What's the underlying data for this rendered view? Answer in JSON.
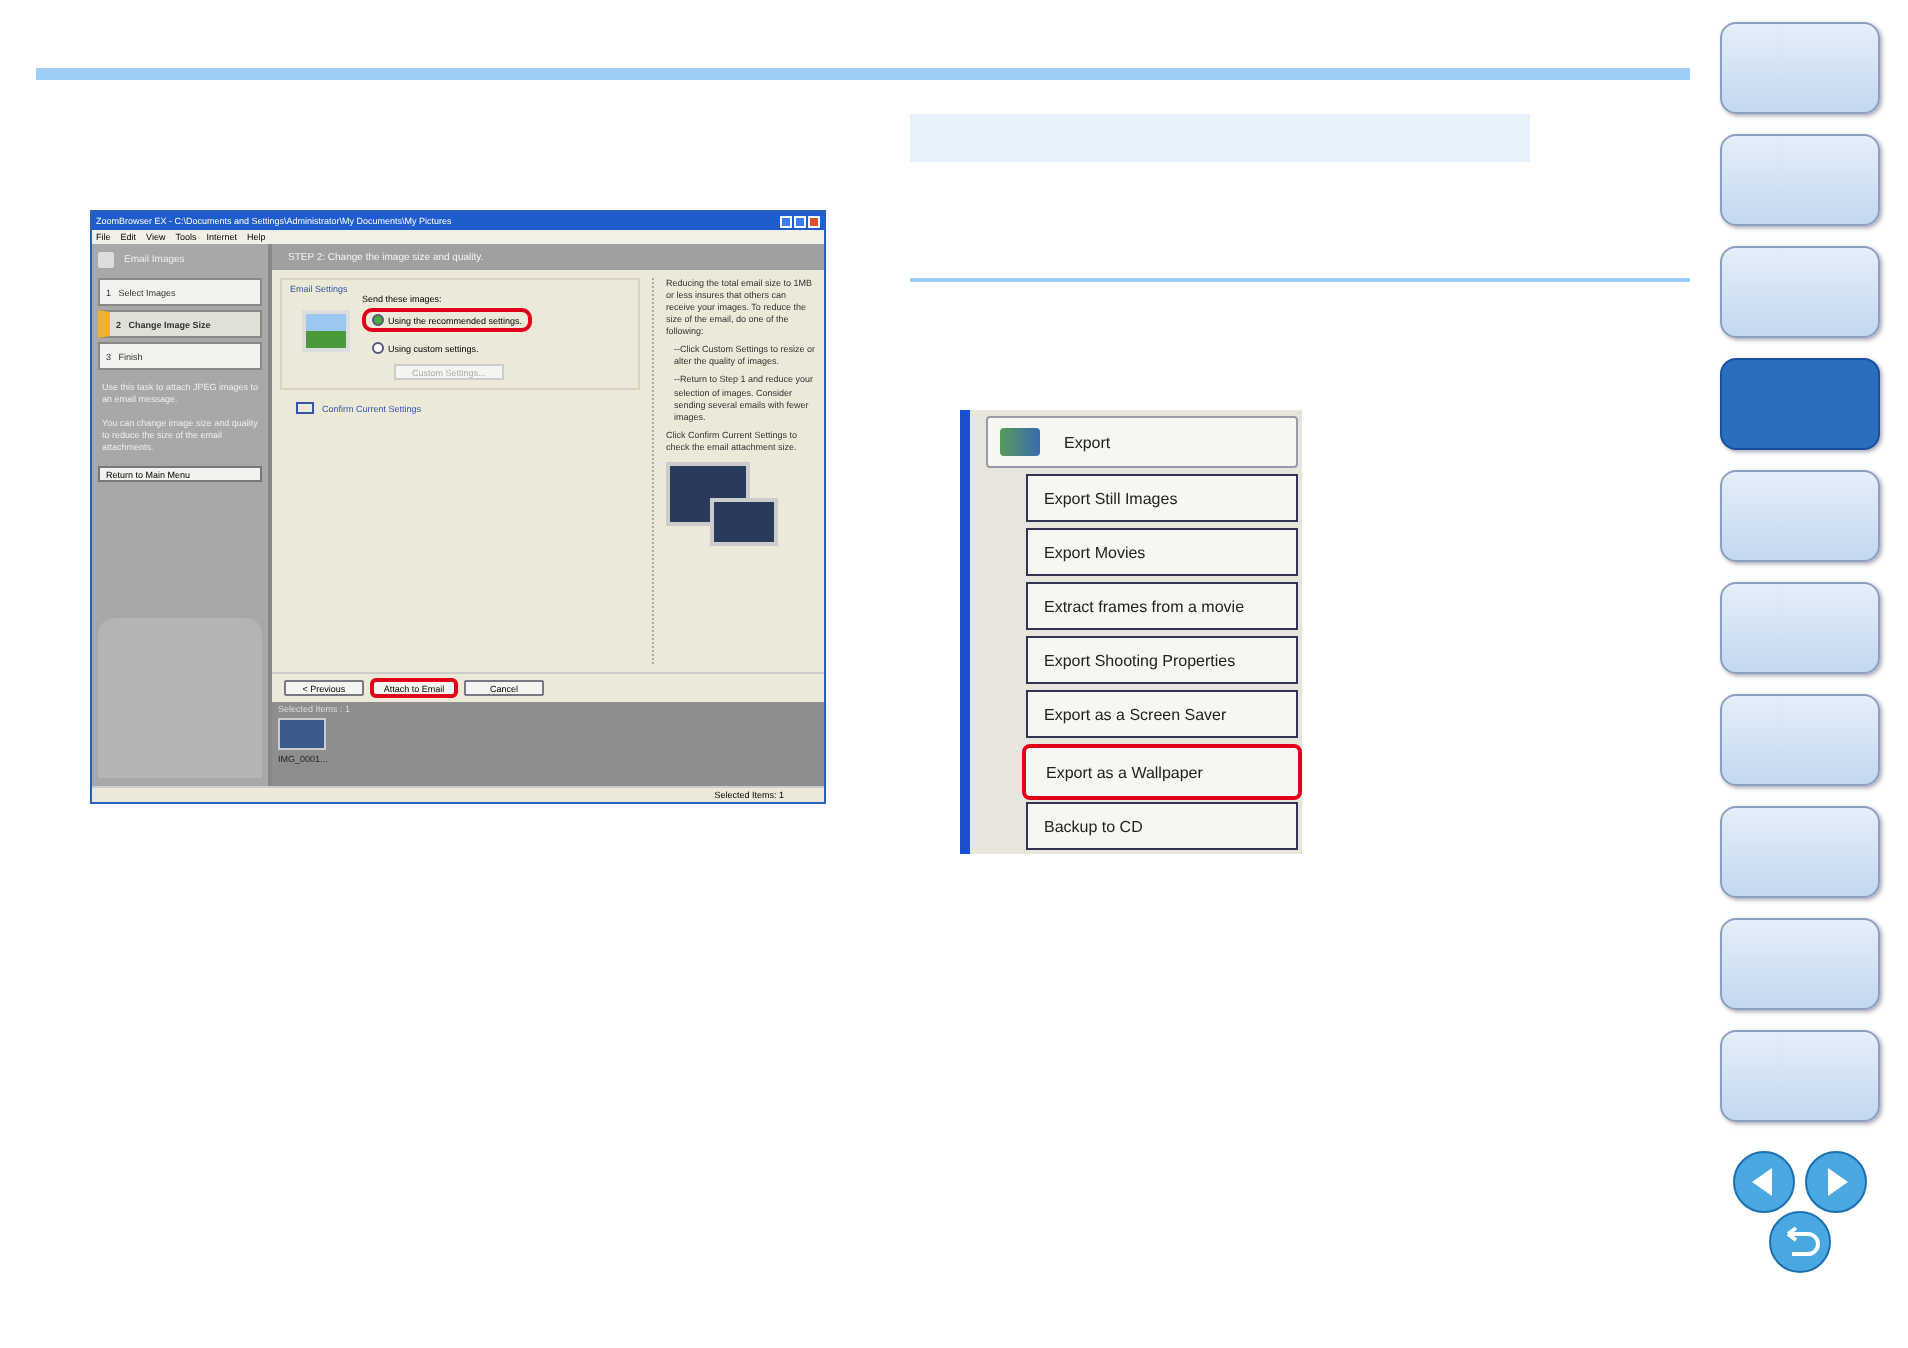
{
  "nav_buttons": [
    {
      "selected": false
    },
    {
      "selected": false
    },
    {
      "selected": false
    },
    {
      "selected": true
    },
    {
      "selected": false
    },
    {
      "selected": false
    },
    {
      "selected": false
    },
    {
      "selected": false
    },
    {
      "selected": false
    },
    {
      "selected": false
    }
  ],
  "screenshot": {
    "title": "ZoomBrowser EX  -  C:\\Documents and Settings\\Administrator\\My Documents\\My Pictures",
    "menu": [
      "File",
      "Edit",
      "View",
      "Tools",
      "Internet",
      "Help"
    ],
    "sidebar": {
      "header": "Email Images",
      "steps": [
        {
          "number": "1",
          "label": "Select Images",
          "selected": false
        },
        {
          "number": "2",
          "label": "Change Image Size",
          "selected": true
        },
        {
          "number": "3",
          "label": "Finish",
          "selected": false
        }
      ],
      "help": [
        "Use this task to attach JPEG images to an email message.",
        "You can change image size and quality to reduce the size of the email attachments."
      ],
      "return_button": "Return to Main Menu"
    },
    "step_title": "STEP 2: Change the image size and quality.",
    "group_title": "Email Settings",
    "prompt": "Send these images:",
    "options": [
      {
        "label": "Using the recommended settings.",
        "selected": true,
        "highlighted": true
      },
      {
        "label": "Using custom settings.",
        "selected": false,
        "highlighted": false
      }
    ],
    "custom_button": "Custom Settings...",
    "confirm_link": "Confirm Current Settings",
    "info": [
      "Reducing the total email size to 1MB or less insures that others can receive your images. To reduce the size of the email, do one of the following:",
      "--Click Custom Settings to resize or alter the quality of images.",
      "--Return to Step 1 and reduce your selection of images. Consider sending several emails with fewer images.",
      "Click Confirm Current Settings to check the email attachment size."
    ],
    "buttons": [
      {
        "label": "< Previous",
        "highlighted": false
      },
      {
        "label": "Attach to Email",
        "highlighted": true
      },
      {
        "label": "Cancel",
        "highlighted": false
      }
    ],
    "selected_items": "Selected Items : 1",
    "thumbnail_caption": "IMG_0001...",
    "status": "Selected Items: 1"
  },
  "export_menu": {
    "header": "Export",
    "items": [
      {
        "label": "Export Still Images",
        "highlighted": false
      },
      {
        "label": "Export Movies",
        "highlighted": false
      },
      {
        "label": "Extract frames from a movie",
        "highlighted": false
      },
      {
        "label": "Export Shooting Properties",
        "highlighted": false
      },
      {
        "label": "Export as a Screen Saver",
        "highlighted": false
      },
      {
        "label": "Export as a Wallpaper",
        "highlighted": true
      },
      {
        "label": "Backup to CD",
        "highlighted": false
      }
    ]
  }
}
